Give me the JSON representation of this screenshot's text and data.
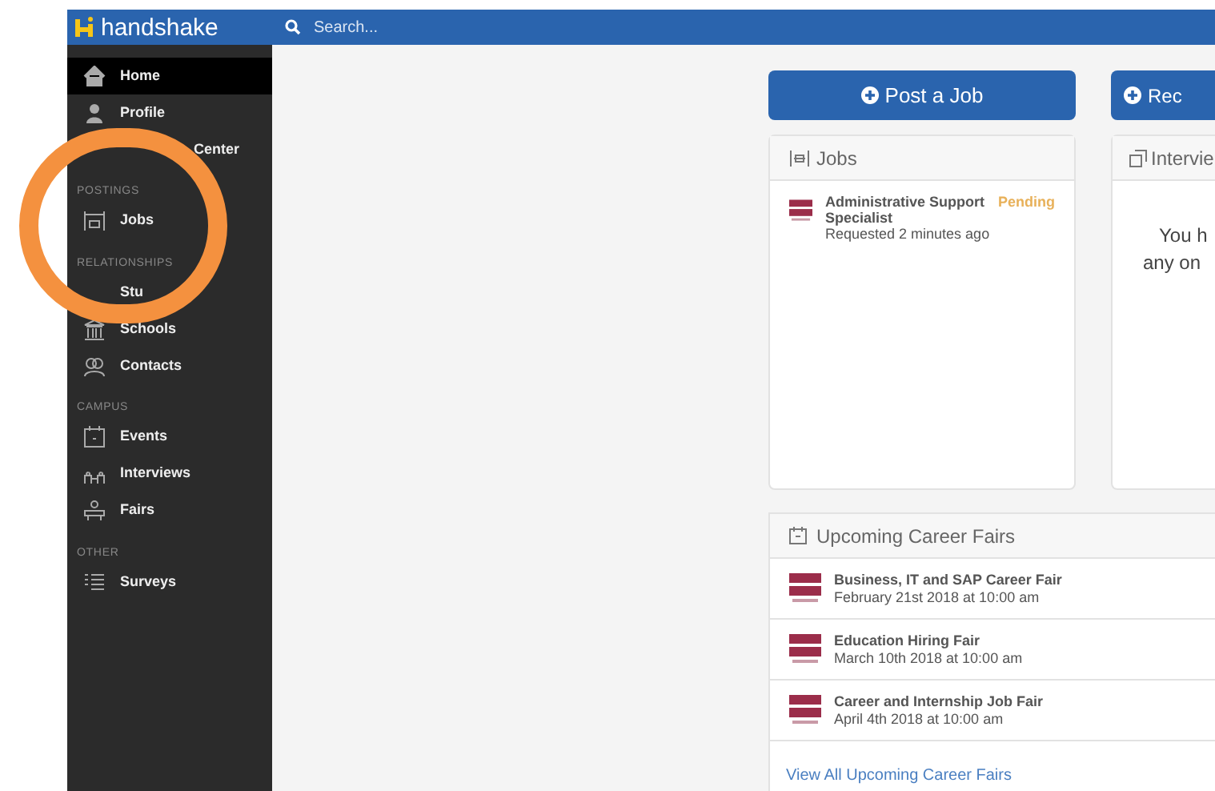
{
  "header": {
    "logo": "handshake",
    "search": {
      "placeholder": "Search..."
    }
  },
  "sidebar": {
    "sections": [
      {
        "items": [
          {
            "label": "Home",
            "selected": true,
            "kind": "normal"
          },
          {
            "label": "Profile",
            "selected": false,
            "kind": "normal"
          },
          {
            "label": "Center",
            "selected": false,
            "kind": "obscured"
          }
        ]
      },
      {
        "heading": "POSTINGS",
        "items": [
          {
            "label": "Jobs",
            "selected": false,
            "kind": "normal"
          }
        ]
      },
      {
        "heading": "RELATIONSHIPS",
        "items": [
          {
            "label": "Stu",
            "selected": false,
            "kind": "obscured"
          },
          {
            "label": "Schools",
            "selected": false,
            "kind": "normal"
          },
          {
            "label": "Contacts",
            "selected": false,
            "kind": "normal"
          }
        ]
      },
      {
        "heading": "CAMPUS",
        "items": [
          {
            "label": "Events",
            "selected": false,
            "kind": "normal"
          },
          {
            "label": "Interviews",
            "selected": false,
            "kind": "normal"
          },
          {
            "label": "Fairs",
            "selected": false,
            "kind": "normal"
          }
        ]
      },
      {
        "heading": "OTHER",
        "items": [
          {
            "label": "Surveys",
            "selected": false,
            "kind": "normal"
          }
        ]
      }
    ]
  },
  "buttons": [
    "Post a Job",
    "Rec"
  ],
  "jobs_card": {
    "title": "Jobs",
    "items": [
      {
        "title": "Administrative Support Specialist",
        "status": "Pending",
        "meta": "Requested 2 minutes ago"
      }
    ]
  },
  "interviews_card": {
    "title": "Intervie",
    "message_lines": [
      "You h",
      "any on"
    ]
  },
  "fairs_card": {
    "title": "Upcoming Career Fairs",
    "items": [
      {
        "title": "Business, IT and SAP Career Fair",
        "date": "February 21st 2018 at 10:00 am"
      },
      {
        "title": "Education Hiring Fair",
        "date": "March 10th 2018 at 10:00 am"
      },
      {
        "title": "Career and Internship Job Fair",
        "date": "April 4th 2018 at 10:00 am"
      }
    ],
    "link": "View All Upcoming Career Fairs"
  },
  "annotation": {
    "kind": "circle",
    "color": "#f4913f"
  }
}
